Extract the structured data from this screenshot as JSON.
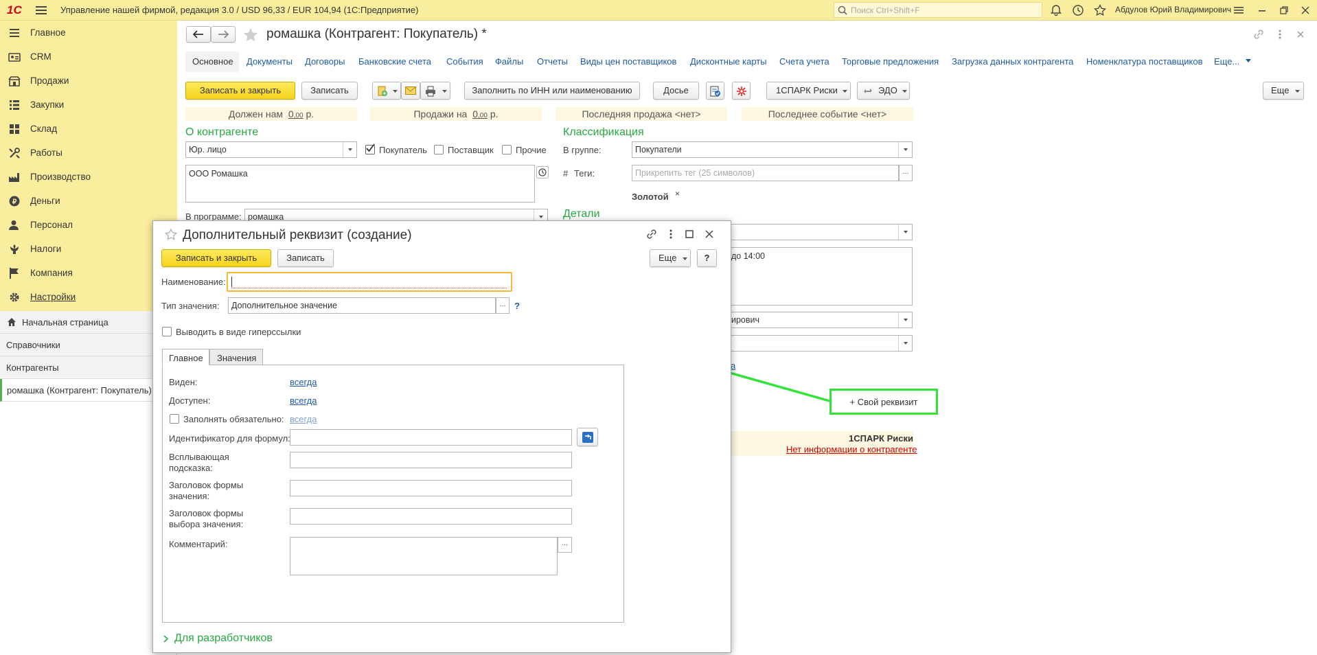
{
  "topbar": {
    "logo": "1С",
    "app_title": "Управление нашей фирмой, редакция 3.0 / USD 96,33 / EUR 104,94  (1С:Предприятие)",
    "search_placeholder": "Поиск Ctrl+Shift+F",
    "user_name": "Абдулов Юрий Владимирович"
  },
  "sidebar": {
    "items": [
      {
        "label": "Главное",
        "icon": "menu-icon"
      },
      {
        "label": "CRM",
        "icon": "crm-icon"
      },
      {
        "label": "Продажи",
        "icon": "sales-icon"
      },
      {
        "label": "Закупки",
        "icon": "purchases-icon"
      },
      {
        "label": "Склад",
        "icon": "warehouse-icon"
      },
      {
        "label": "Работы",
        "icon": "tools-icon"
      },
      {
        "label": "Производство",
        "icon": "production-icon"
      },
      {
        "label": "Деньги",
        "icon": "money-icon"
      },
      {
        "label": "Персонал",
        "icon": "personnel-icon"
      },
      {
        "label": "Налоги",
        "icon": "taxes-icon"
      },
      {
        "label": "Компания",
        "icon": "company-icon"
      },
      {
        "label": "Настройки",
        "icon": "settings-icon"
      }
    ],
    "opened": [
      {
        "label": "Начальная страница"
      },
      {
        "label": "Справочники"
      },
      {
        "label": "Контрагенты"
      },
      {
        "label": "ромашка (Контрагент: Покупатель)"
      }
    ]
  },
  "form": {
    "title": "ромашка (Контрагент: Покупатель) *",
    "tabs": [
      "Основное",
      "Документы",
      "Договоры",
      "Банковские счета",
      "События",
      "Файлы",
      "Отчеты",
      "Виды цен поставщиков",
      "Дисконтные карты",
      "Счета учета",
      "Торговые предложения",
      "Загрузка данных контрагента",
      "Номенклатура поставщиков",
      "Еще..."
    ],
    "toolbar": {
      "save_close": "Записать и закрыть",
      "save": "Записать",
      "fill_inn": "Заполнить по ИНН или наименованию",
      "dossier": "Досье",
      "spark": "1СПАРК Риски",
      "edo": "ЭДО",
      "more": "Еще"
    },
    "stats": {
      "owes_prefix": "Должен нам",
      "owes_value": "0",
      "owes_cents": ",00",
      "owes_suffix": "р.",
      "sales_prefix": "Продажи на",
      "sales_value": "0",
      "sales_cents": ",00",
      "sales_suffix": "р.",
      "last_sale": "Последняя продажа <нет>",
      "last_event": "Последнее событие <нет>"
    },
    "about": {
      "heading": "О контрагенте",
      "type": "Юр. лицо",
      "buyer": "Покупатель",
      "supplier": "Поставщик",
      "other": "Прочие",
      "name": "ООО Ромашка",
      "in_program_label": "В программе:",
      "in_program_value": "ромашка"
    },
    "classification": {
      "heading": "Классификация",
      "group_label": "В группе:",
      "group_value": "Покупатели",
      "tags_label": "Теги:",
      "tags_placeholder": "Прикрепить тег (25 символов)",
      "tag": "Золотой",
      "tag_remove": "×"
    },
    "details": {
      "heading": "Детали",
      "note_tail": "до 14:00",
      "responsible_tail": "ирович",
      "link_tail": "а"
    },
    "custom_attr_button": "+ Свой реквизит",
    "spark_block": {
      "title": "1СПАРК Риски",
      "no_info": "Нет информации о контрагенте"
    }
  },
  "dialog": {
    "title": "Дополнительный реквизит (создание)",
    "save_close": "Записать и закрыть",
    "save": "Записать",
    "more": "Еще",
    "help": "?",
    "name_label": "Наименование:",
    "name_value": "",
    "value_type_label": "Тип значения:",
    "value_type_value": "Дополнительное значение",
    "value_type_help": "?",
    "hyperlink_label": "Выводить в виде гиперссылки",
    "tabs": [
      "Главное",
      "Значения"
    ],
    "visible_label": "Виден:",
    "visible_value": "всегда",
    "available_label": "Доступен:",
    "available_value": "всегда",
    "required_label": "Заполнять обязательно:",
    "required_value": "всегда",
    "formula_id_label": "Идентификатор для формул:",
    "tooltip_label": "Всплывающая подсказка:",
    "value_form_title_label": "Заголовок формы значения:",
    "choice_form_title_label": "Заголовок формы выбора значения:",
    "comment_label": "Комментарий:",
    "for_developers": "Для разработчиков"
  },
  "colors": {
    "accent_yellow": "#fbed9e",
    "section_green": "#27a844",
    "link_blue": "#1d5ba7",
    "highlight_green": "#33e33a",
    "error_red": "#d40000"
  }
}
